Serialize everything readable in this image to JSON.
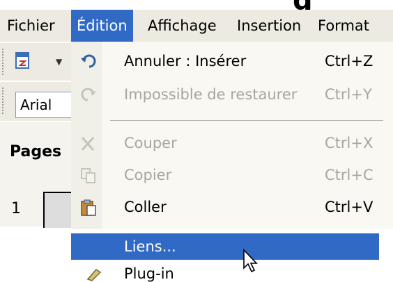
{
  "menubar": {
    "items": [
      {
        "label": "Fichier",
        "active": false
      },
      {
        "label": "Édition",
        "active": true
      },
      {
        "label": "Affichage",
        "active": false
      },
      {
        "label": "Insertion",
        "active": false
      },
      {
        "label": "Format",
        "active": false
      }
    ]
  },
  "toolbar": {
    "font_name": "Arial"
  },
  "pages_panel": {
    "title": "Pages",
    "page_number": "1"
  },
  "edit_menu": {
    "items": [
      {
        "label": "Annuler : Insérer",
        "shortcut": "Ctrl+Z",
        "icon": "undo-icon",
        "enabled": true
      },
      {
        "label": "Impossible de restaurer",
        "shortcut": "Ctrl+Y",
        "icon": "redo-icon",
        "enabled": false
      },
      {
        "label": "Couper",
        "shortcut": "Ctrl+X",
        "icon": "cut-icon",
        "enabled": false
      },
      {
        "label": "Copier",
        "shortcut": "Ctrl+C",
        "icon": "copy-icon",
        "enabled": false
      },
      {
        "label": "Coller",
        "shortcut": "Ctrl+V",
        "icon": "paste-icon",
        "enabled": true
      }
    ]
  },
  "links_menu": {
    "highlighted_label": "Liens...",
    "next_label": "Plug-in"
  },
  "colors": {
    "menu_highlight": "#316ac5",
    "menu_bg": "#f9f8f3",
    "toolbar_bg": "#eceae1",
    "disabled_text": "#a8a69c"
  }
}
